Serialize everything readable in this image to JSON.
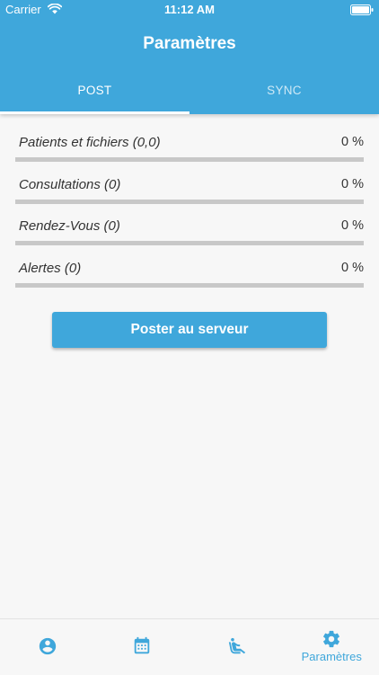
{
  "colors": {
    "accent": "#3fa7db"
  },
  "status_bar": {
    "carrier": "Carrier",
    "time": "11:12 AM",
    "wifi_icon": "wifi-icon",
    "battery_icon": "battery-icon"
  },
  "header": {
    "title": "Paramètres"
  },
  "tabs": [
    {
      "label": "POST",
      "active": true
    },
    {
      "label": "SYNC",
      "active": false
    }
  ],
  "progress_items": [
    {
      "label": "Patients et fichiers (0,0)",
      "value": "0 %",
      "fraction": 0
    },
    {
      "label": "Consultations (0)",
      "value": "0 %",
      "fraction": 0
    },
    {
      "label": "Rendez-Vous (0)",
      "value": "0 %",
      "fraction": 0
    },
    {
      "label": "Alertes (0)",
      "value": "0 %",
      "fraction": 0
    }
  ],
  "post_button": {
    "label": "Poster au serveur"
  },
  "bottom_nav": [
    {
      "icon": "account-circle-icon",
      "label": ""
    },
    {
      "icon": "calendar-icon",
      "label": ""
    },
    {
      "icon": "seat-recline-icon",
      "label": ""
    },
    {
      "icon": "gear-icon",
      "label": "Paramètres"
    }
  ]
}
